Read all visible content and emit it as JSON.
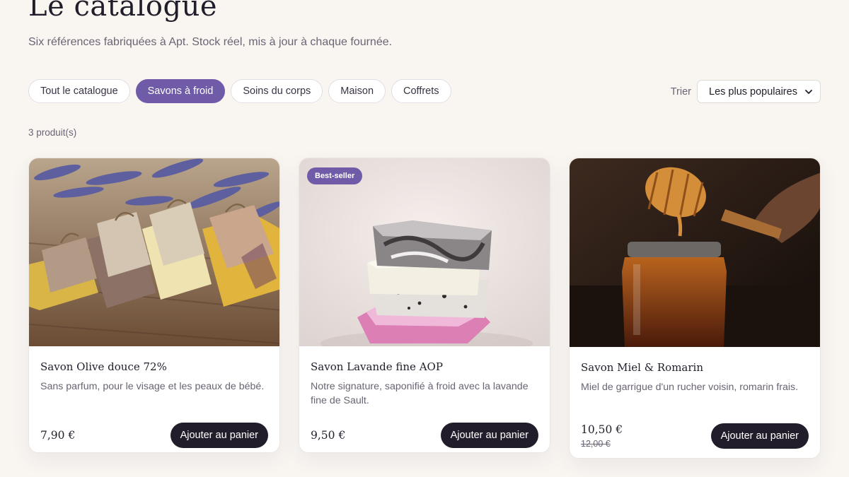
{
  "header": {
    "title": "Le catalogue",
    "subtitle": "Six références fabriquées à Apt. Stock réel, mis à jour à chaque fournée."
  },
  "filters": [
    {
      "label": "Tout le catalogue",
      "active": false
    },
    {
      "label": "Savons à froid",
      "active": true
    },
    {
      "label": "Soins du corps",
      "active": false
    },
    {
      "label": "Maison",
      "active": false
    },
    {
      "label": "Coffrets",
      "active": false
    }
  ],
  "sort": {
    "label": "Trier",
    "selected": "Les plus populaires"
  },
  "results": {
    "count_text": "3 produit(s)"
  },
  "products": [
    {
      "name": "Savon Olive douce 72%",
      "description": "Sans parfum, pour le visage et les peaux de bébé.",
      "price": "7,90 €",
      "button": "Ajouter au panier",
      "image": "soap-bars-lavender-photo"
    },
    {
      "name": "Savon Lavande fine AOP",
      "description": "Notre signature, saponifié à froid avec la lavande fine de Sault.",
      "price": "9,50 €",
      "badge": "Best-seller",
      "button": "Ajouter au panier",
      "image": "stacked-soaps-photo"
    },
    {
      "name": "Savon Miel & Romarin",
      "description": "Miel de garrigue d'un rucher voisin, romarin frais.",
      "price": "10,50 €",
      "old_price": "12,00 €",
      "button": "Ajouter au panier",
      "image": "honey-jar-dipper-photo"
    }
  ],
  "colors": {
    "accent": "#6f5ba7",
    "dark": "#221d2a",
    "background": "#f9f6f2",
    "muted": "#6a6474"
  }
}
